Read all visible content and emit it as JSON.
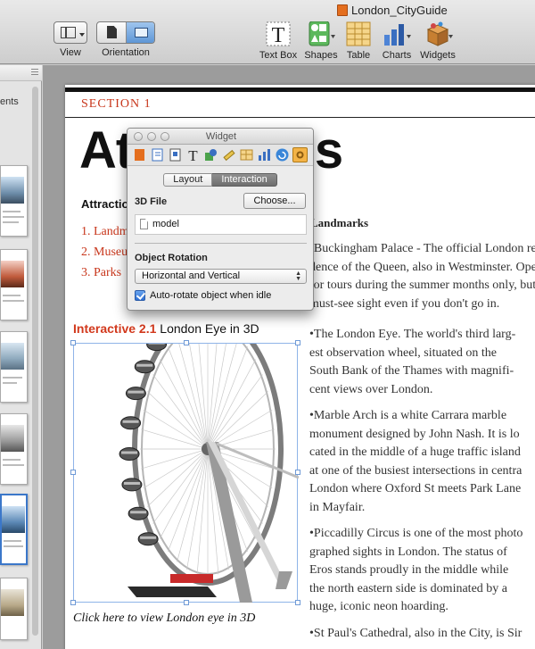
{
  "window": {
    "title": "London_CityGuide"
  },
  "toolbar": {
    "view_label": "View",
    "orientation_label": "Orientation",
    "textbox_label": "Text Box",
    "shapes_label": "Shapes",
    "table_label": "Table",
    "charts_label": "Charts",
    "widgets_label": "Widgets"
  },
  "sidebar": {
    "visible_label": "ents"
  },
  "page": {
    "section_label": "SECTION 1",
    "title": "Attractions",
    "attractions_heading": "Attractions",
    "attractions_list": [
      "1. Landmarks",
      "2. Museums",
      "3. Parks"
    ],
    "column_heading": "Landmarks",
    "body_paragraphs": [
      [
        "•Buckingham Palace - The official London resi-",
        "dence of the Queen, also in Westminster. Open",
        "for tours during the summer months only, but a",
        "must-see sight even if you don't go in."
      ],
      [
        "•The London Eye. The world's third larg-",
        "est observation wheel, situated on the",
        "South Bank of the Thames with magnifi-",
        "cent views over London."
      ],
      [
        "•Marble Arch is a white Carrara marble",
        "monument designed by John Nash. It is lo",
        "cated in the middle of a huge traffic island",
        "at one of the busiest intersections in centra",
        "London where Oxford St meets Park Lane",
        "in Mayfair."
      ],
      [
        "•Piccadilly Circus is one of the most photo",
        "graphed sights in London. The status of",
        "Eros stands proudly in the middle while",
        "the north eastern side is dominated by a",
        "huge, iconic neon hoarding."
      ],
      [
        "•St Paul's Cathedral, also in the City, is Sir"
      ]
    ],
    "interactive_label": "Interactive 2.1",
    "interactive_title": "London Eye in 3D",
    "click_caption": "Click here to view London eye in 3D"
  },
  "inspector": {
    "title": "Widget",
    "tab_layout": "Layout",
    "tab_interaction": "Interaction",
    "file_heading": "3D File",
    "choose_button": "Choose...",
    "model_name": "model",
    "rotation_heading": "Object Rotation",
    "rotation_value": "Horizontal and Vertical",
    "autorotate_label": "Auto-rotate object when idle",
    "autorotate_checked": true
  },
  "colors": {
    "accent_red": "#c8361b",
    "selection_blue": "#3b77c9"
  }
}
